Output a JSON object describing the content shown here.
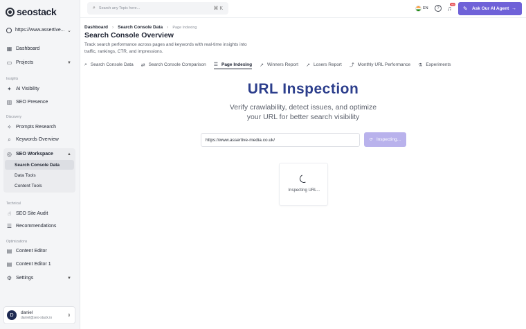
{
  "brand": {
    "name": "seostack"
  },
  "sidebar": {
    "site": "https://www.assertive...",
    "items": {
      "dashboard": "Dashboard",
      "projects": "Projects",
      "ai_visibility": "AI Visibility",
      "seo_presence": "SEO Presence",
      "prompts_research": "Prompts Research",
      "keywords_overview": "Keywords Overview",
      "seo_workspace": "SEO Workspace",
      "search_console_data": "Search Console Data",
      "data_tools": "Data Tools",
      "content_tools": "Content Tools",
      "seo_site_audit": "SEO Site Audit",
      "recommendations": "Recommendations",
      "content_editor": "Content Editor",
      "content_editor_1": "Content Editor 1",
      "settings": "Settings"
    },
    "sections": {
      "insights": "Insights",
      "discovery": "Discovery",
      "technical": "Technical",
      "optimizations": "Optimizations"
    },
    "user": {
      "initial": "D",
      "name": "daniel",
      "email": "daniel@seo-stack.io"
    }
  },
  "header": {
    "search_placeholder": "Search any Topic here...",
    "shortcut": "⌘ K",
    "language": "EN",
    "notification_count": "99",
    "agent_button": "Ask Our AI Agent"
  },
  "breadcrumb": {
    "items": [
      "Dashboard",
      "Search Console Data"
    ],
    "current": "Page Indexing"
  },
  "page": {
    "title": "Search Console Overview",
    "description": "Track search performance across pages and keywords with real-time insights into traffic, rankings, CTR, and impressions."
  },
  "tabs": [
    {
      "label": "Search Console Data",
      "icon": "search-icon"
    },
    {
      "label": "Search Console Comparison",
      "icon": "compare-icon"
    },
    {
      "label": "Page Indexing",
      "icon": "list-icon"
    },
    {
      "label": "Winners Report",
      "icon": "trend-up-icon"
    },
    {
      "label": "Losers Report",
      "icon": "trend-icon"
    },
    {
      "label": "Monthly URL Performance",
      "icon": "chart-line-icon"
    },
    {
      "label": "Experiments",
      "icon": "flask-icon"
    }
  ],
  "inspection": {
    "title": "URL Inspection",
    "subtitle": "Verify crawlability, detect issues, and optimize your URL for better search visibility",
    "url_value": "https://www.assertive-media.co.uk/",
    "button_label": "Inspecting...",
    "status_text": "Inspecting URL..."
  },
  "colors": {
    "accent": "#6f62d8",
    "hero_title": "#2c3e8c",
    "button_disabled": "#b9b2ec"
  }
}
